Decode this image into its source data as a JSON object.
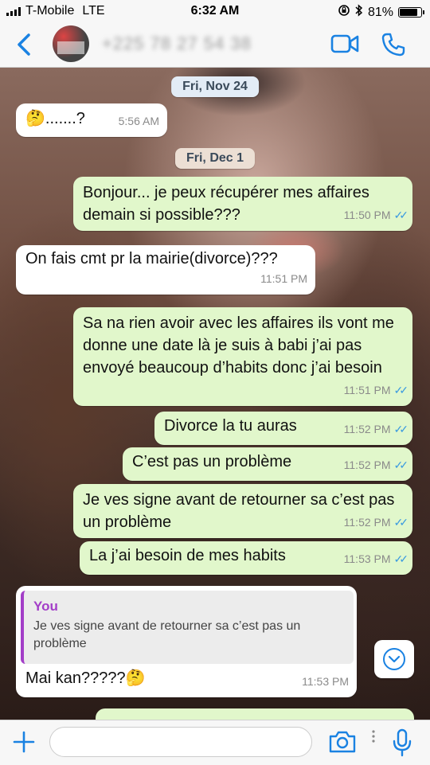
{
  "status_bar": {
    "carrier": "T-Mobile",
    "network": "LTE",
    "time": "6:32 AM",
    "battery": "81%"
  },
  "header": {
    "contact": "+225 78 27 54 38",
    "icons": [
      "back-chevron-icon",
      "avatar",
      "video-call-icon",
      "phone-call-icon"
    ]
  },
  "dates": {
    "first": "Fri, Nov 24",
    "second": "Fri, Dec 1"
  },
  "messages": [
    {
      "dir": "in",
      "text": "🤔.......?",
      "time": "5:56 AM"
    },
    {
      "dir": "out",
      "text": "Bonjour... je peux récupérer mes affaires demain si possible???",
      "time": "11:50 PM"
    },
    {
      "dir": "in",
      "text": "On fais cmt pr la mairie(divorce)???",
      "time": "11:51 PM"
    },
    {
      "dir": "out",
      "text": "Sa na rien avoir avec les affaires ils vont me donne une date là je suis à babi j’ai pas envoyé beaucoup d’habits donc j’ai besoin",
      "time": "11:51 PM"
    },
    {
      "dir": "out",
      "text": "Divorce la tu auras",
      "time": "11:52 PM"
    },
    {
      "dir": "out",
      "text": "C’est pas un problème",
      "time": "11:52 PM"
    },
    {
      "dir": "out",
      "text": "Je ves signe avant de retourner sa c’est pas un problème",
      "time": "11:52 PM"
    },
    {
      "dir": "out",
      "text": "La j’ai besoin de mes habits",
      "time": "11:53 PM"
    },
    {
      "dir": "in",
      "quote_author": "You",
      "quote_text": "Je ves signe avant de retourner sa c’est pas un problème",
      "text": "Mai kan?????🤔",
      "time": "11:53 PM"
    }
  ],
  "read_ticks": "✓✓",
  "colors": {
    "outgoing": "#e1f7cb",
    "incoming": "#ffffff",
    "accent": "#1a82e2",
    "quote_bar": "#a33ec8",
    "tick": "#3a9ae0"
  }
}
